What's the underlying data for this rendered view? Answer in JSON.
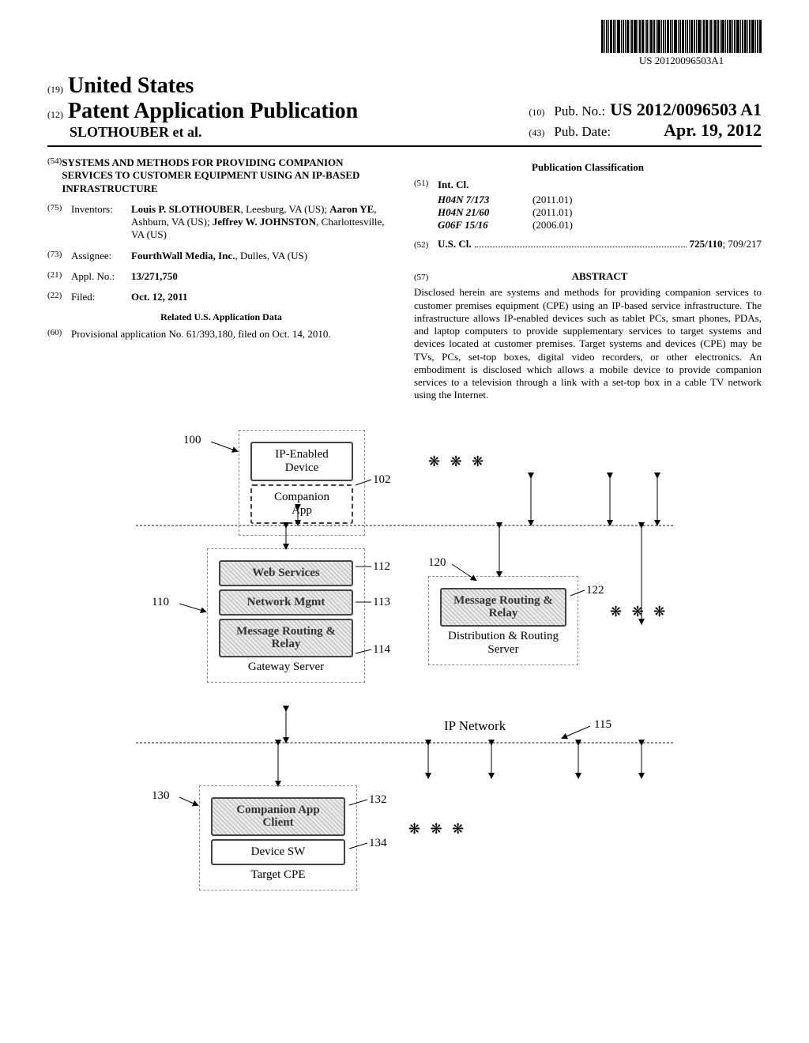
{
  "barcode_number": "US 20120096503A1",
  "header": {
    "code19": "(19)",
    "country": "United States",
    "code12": "(12)",
    "pub_type": "Patent Application Publication",
    "authors": "SLOTHOUBER et al.",
    "code10": "(10)",
    "pubno_label": "Pub. No.:",
    "pubno": "US 2012/0096503 A1",
    "code43": "(43)",
    "pubdate_label": "Pub. Date:",
    "pubdate": "Apr. 19, 2012"
  },
  "left": {
    "code54": "(54)",
    "title": "SYSTEMS AND METHODS FOR PROVIDING COMPANION SERVICES TO CUSTOMER EQUIPMENT USING AN IP-BASED INFRASTRUCTURE",
    "code75": "(75)",
    "inventors_label": "Inventors:",
    "inventors": "Louis P. SLOTHOUBER, Leesburg, VA (US); Aaron YE, Ashburn, VA (US); Jeffrey W. JOHNSTON, Charlottesville, VA (US)",
    "code73": "(73)",
    "assignee_label": "Assignee:",
    "assignee": "FourthWall Media, Inc., Dulles, VA (US)",
    "code21": "(21)",
    "applno_label": "Appl. No.:",
    "applno": "13/271,750",
    "code22": "(22)",
    "filed_label": "Filed:",
    "filed": "Oct. 12, 2011",
    "related_head": "Related U.S. Application Data",
    "code60": "(60)",
    "provisional": "Provisional application No. 61/393,180, filed on Oct. 14, 2010."
  },
  "right": {
    "pubclass_head": "Publication Classification",
    "code51": "(51)",
    "intcl_label": "Int. Cl.",
    "intcl": [
      {
        "code": "H04N 7/173",
        "date": "(2011.01)"
      },
      {
        "code": "H04N 21/60",
        "date": "(2011.01)"
      },
      {
        "code": "G06F 15/16",
        "date": "(2006.01)"
      }
    ],
    "code52": "(52)",
    "uscl_label": "U.S. Cl.",
    "uscl_main": "725/110",
    "uscl_rest": "; 709/217",
    "code57": "(57)",
    "abstract_head": "ABSTRACT",
    "abstract": "Disclosed herein are systems and methods for providing companion services to customer premises equipment (CPE) using an IP-based service infrastructure. The infrastructure allows IP-enabled devices such as tablet PCs, smart phones, PDAs, and laptop computers to provide supplementary services to target systems and devices located at customer premises. Target systems and devices (CPE) may be TVs, PCs, set-top boxes, digital video recorders, or other electronics. An embodiment is disclosed which allows a mobile device to provide companion services to a television through a link with a set-top box in a cable TV network using the Internet."
  },
  "fig": {
    "r100": "100",
    "ip_device": "IP-Enabled Device",
    "companion_app": "Companion App",
    "r102": "102",
    "r110": "110",
    "web_services": "Web Services",
    "r112": "112",
    "network_mgmt": "Network Mgmt",
    "r113": "113",
    "msg_routing": "Message Routing & Relay",
    "r114": "114",
    "gateway_server": "Gateway Server",
    "r120": "120",
    "r122": "122",
    "dist_routing": "Distribution & Routing Server",
    "ip_network": "IP Network",
    "r115": "115",
    "r130": "130",
    "companion_client": "Companion App Client",
    "r132": "132",
    "device_sw": "Device SW",
    "r134": "134",
    "target_cpe": "Target CPE"
  }
}
